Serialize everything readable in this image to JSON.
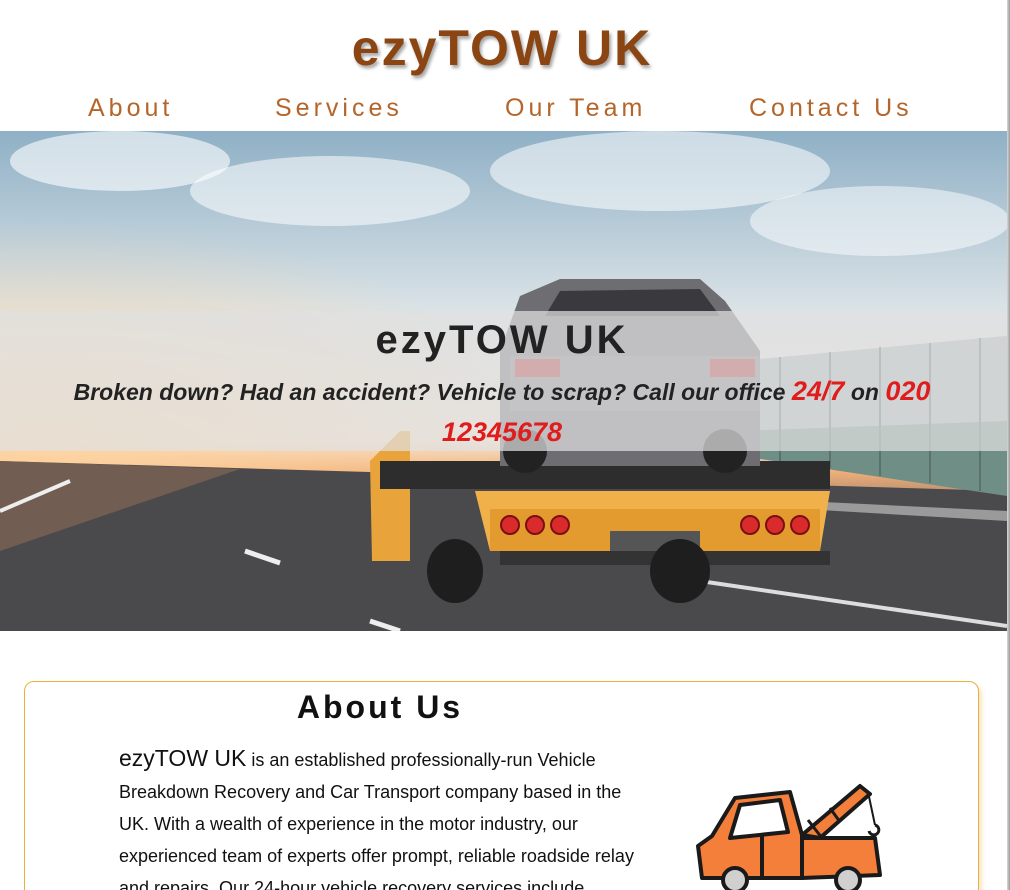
{
  "header": {
    "brand": "ezyTOW UK"
  },
  "nav": {
    "items": [
      {
        "label": "About"
      },
      {
        "label": "Services"
      },
      {
        "label": "Our Team"
      },
      {
        "label": "Contact Us"
      }
    ]
  },
  "hero": {
    "title": "ezyTOW UK",
    "tagline_part1": "Broken down? Had an accident? Vehicle to scrap? Call our office ",
    "tagline_hours": "24/7",
    "tagline_on": " on ",
    "tagline_phone": "020 12345678",
    "image_icon": "tow-truck-photo"
  },
  "about": {
    "title": "About Us",
    "brandname": "ezyTOW UK",
    "text": " is an established professionally-run Vehicle Breakdown Recovery and Car Transport company based in the UK. With a wealth of experience in the motor industry, our experienced team of experts offer prompt, reliable roadside relay and repairs. Our 24-hour vehicle recovery services include",
    "illustration_icon": "tow-truck-icon"
  },
  "colors": {
    "brand": "#8b4513",
    "nav": "#b5652a",
    "accent_red": "#e01c1c",
    "card_border": "#e9b13c",
    "truck_orange": "#f47f3a"
  }
}
